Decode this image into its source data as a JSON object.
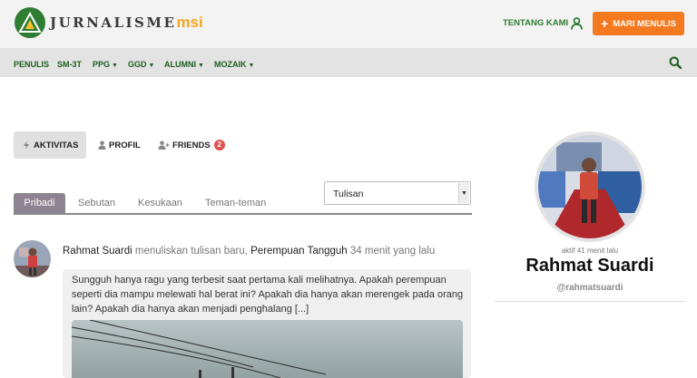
{
  "brand": {
    "name_part1": "JURNALISME",
    "name_part2": "msi"
  },
  "header": {
    "about_label": "TENTANG KAMI",
    "write_label": "MARI MENULIS"
  },
  "nav": {
    "items": [
      "PENULIS",
      "SM-3T",
      "PPG",
      "GGD",
      "ALUMNI",
      "MOZAIK"
    ]
  },
  "profile_tabs": {
    "activity": "AKTIVITAS",
    "profile": "PROFIL",
    "friends": "FRIENDS",
    "friends_count": "2"
  },
  "sub_tabs": [
    "Pribadi",
    "Sebutan",
    "Kesukaan",
    "Teman-teman"
  ],
  "filter": {
    "selected": "Tulisan"
  },
  "activity": {
    "author": "Rahmat Suardi",
    "action": " menuliskan tulisan baru, ",
    "post_title": "Perempuan Tangguh",
    "time": " 34 menit yang lalu",
    "excerpt": "Sungguh hanya ragu yang terbesit saat pertama kali melihatnya. Apakah perempuan seperti dia mampu melewati hal berat ini? Apakah dia hanya akan merengek pada orang lain? Apakah dia hanya akan menjadi penghalang [...]"
  },
  "profile": {
    "last_active": "aktif 41 menit lalu",
    "name": "Rahmat Suardi",
    "handle": "@rahmatsuardi"
  },
  "colors": {
    "brand_green": "#2e7d32",
    "accent_orange": "#f4791f",
    "active_tab": "#8e8390"
  }
}
